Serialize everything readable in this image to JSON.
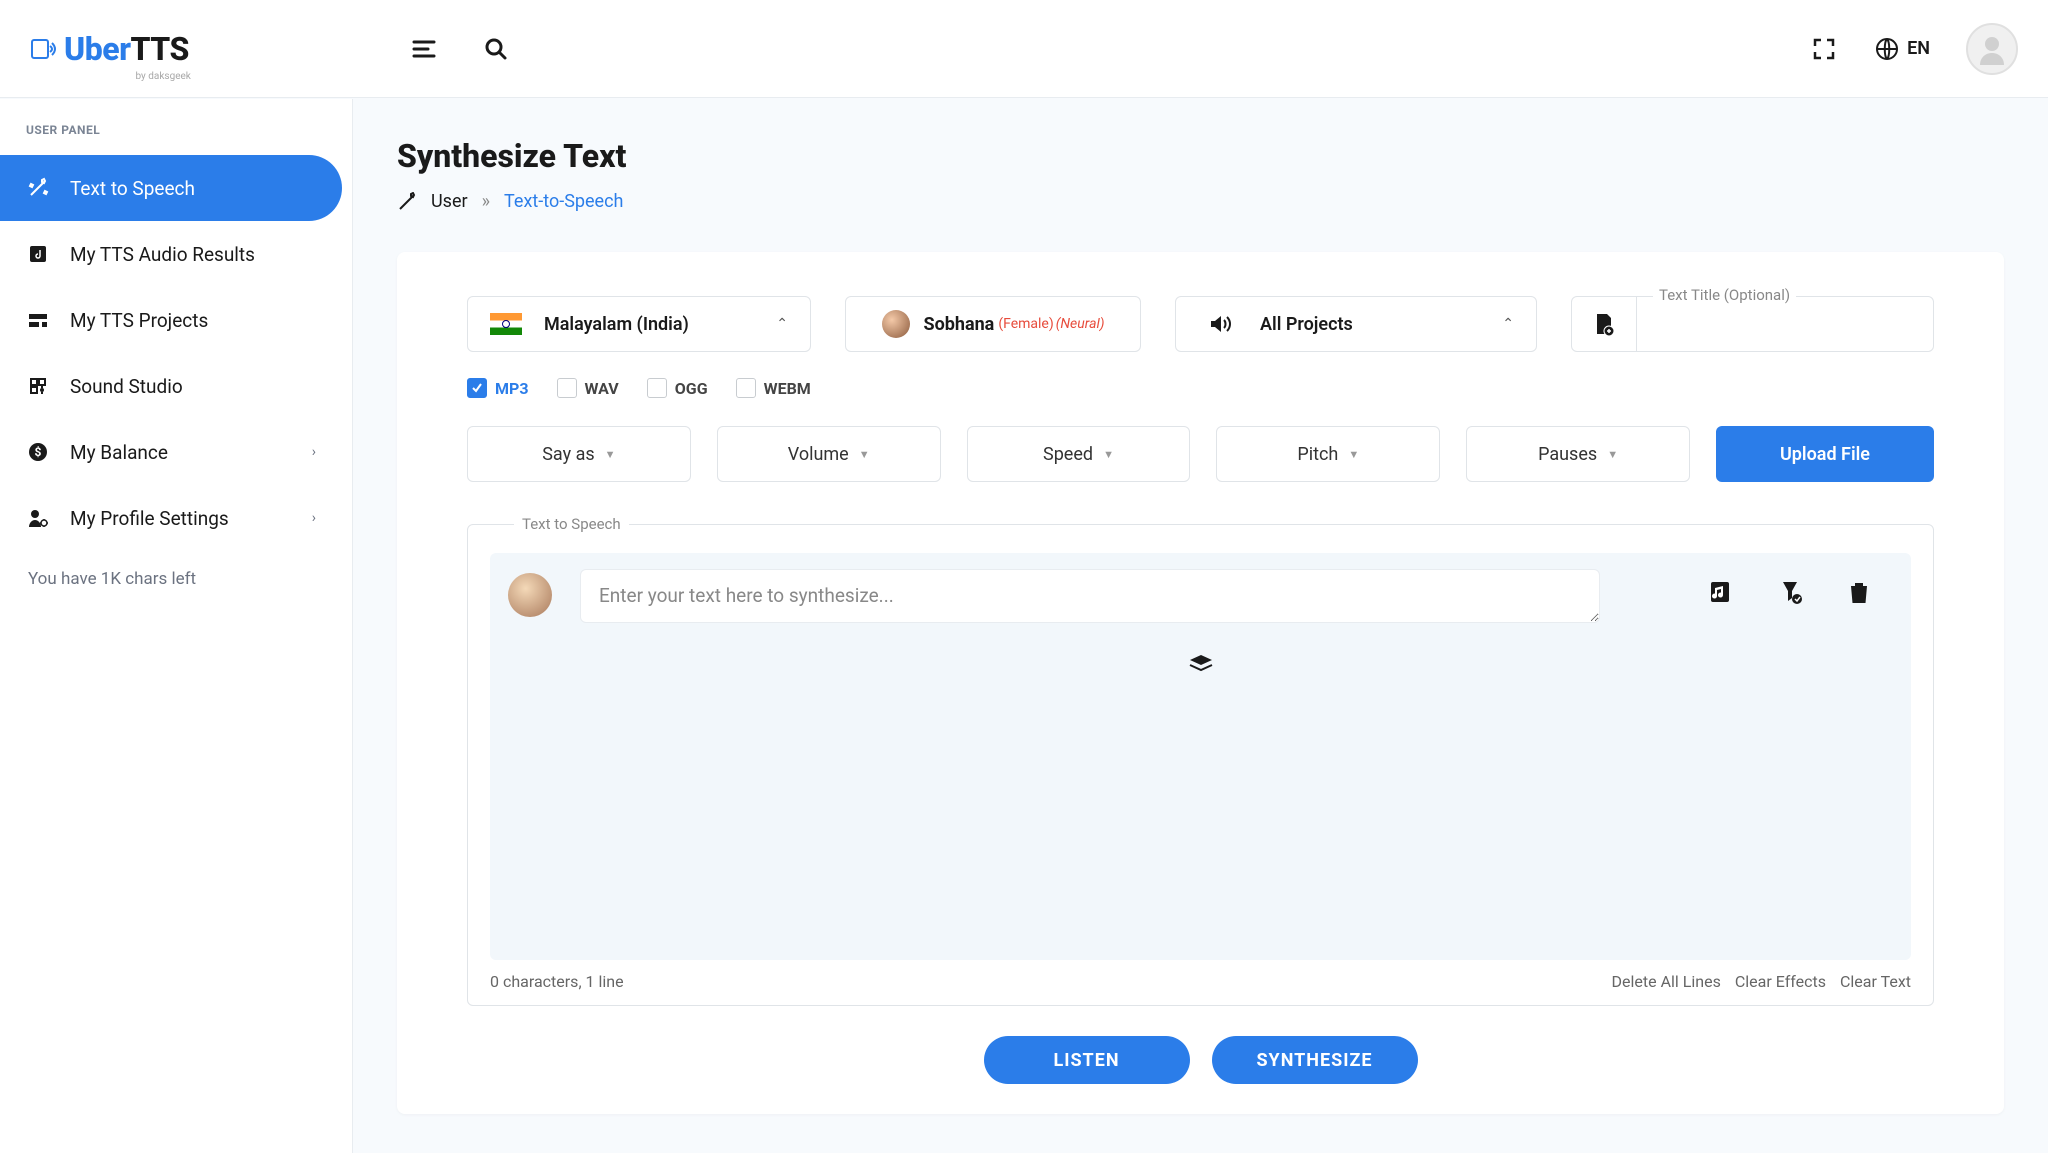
{
  "header": {
    "logo_uber": "Uber",
    "logo_tts": "TTS",
    "logo_sub": "by daksgeek",
    "lang": "EN"
  },
  "sidebar": {
    "heading": "USER PANEL",
    "items": [
      {
        "label": "Text to Speech"
      },
      {
        "label": "My TTS Audio Results"
      },
      {
        "label": "My TTS Projects"
      },
      {
        "label": "Sound Studio"
      },
      {
        "label": "My Balance"
      },
      {
        "label": "My Profile Settings"
      }
    ],
    "note": "You have 1K chars left"
  },
  "page": {
    "title": "Synthesize Text",
    "bc_user": "User",
    "bc_current": "Text-to-Speech"
  },
  "selectors": {
    "language": "Malayalam (India)",
    "voice_name": "Sobhana",
    "voice_gender": "(Female)",
    "voice_type": "(Neural)",
    "project": "All Projects",
    "title_label": "Text Title (Optional)",
    "title_value": ""
  },
  "formats": [
    {
      "label": "MP3",
      "checked": true
    },
    {
      "label": "WAV",
      "checked": false
    },
    {
      "label": "OGG",
      "checked": false
    },
    {
      "label": "WEBM",
      "checked": false
    }
  ],
  "controls": {
    "say_as": "Say as",
    "volume": "Volume",
    "speed": "Speed",
    "pitch": "Pitch",
    "pauses": "Pauses",
    "upload": "Upload File"
  },
  "editor": {
    "label": "Text to Speech",
    "placeholder": "Enter your text here to synthesize...",
    "counter": "0 characters, 1 line",
    "delete_all": "Delete All Lines",
    "clear_effects": "Clear Effects",
    "clear_text": "Clear Text"
  },
  "actions": {
    "listen": "LISTEN",
    "synthesize": "SYNTHESIZE"
  }
}
